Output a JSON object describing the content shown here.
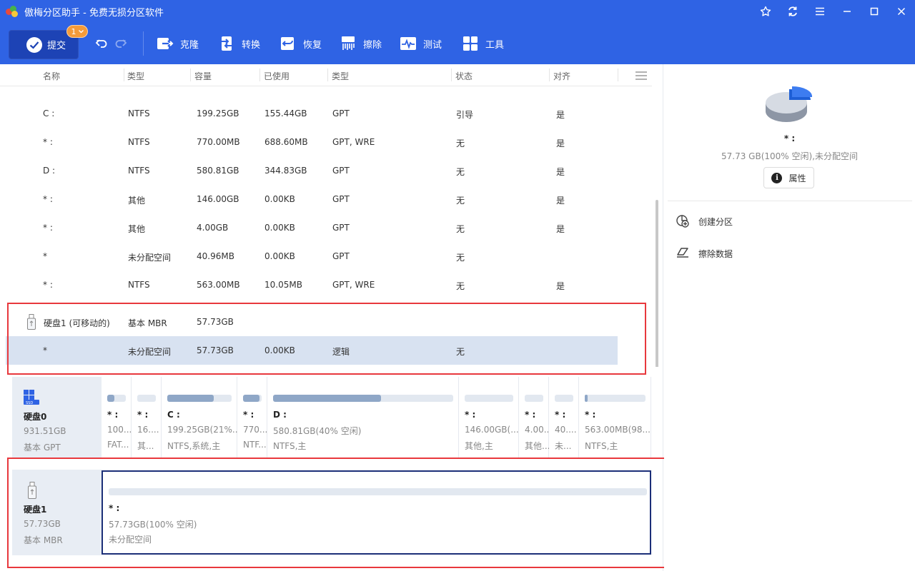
{
  "app": {
    "title": "傲梅分区助手 - 免费无损分区软件"
  },
  "toolbar": {
    "commit_label": "提交",
    "pending_count": "1",
    "tools": [
      {
        "label": "克隆",
        "icon": "clone-icon"
      },
      {
        "label": "转换",
        "icon": "convert-icon"
      },
      {
        "label": "恢复",
        "icon": "recover-icon"
      },
      {
        "label": "擦除",
        "icon": "wipe-icon"
      },
      {
        "label": "测试",
        "icon": "test-icon"
      },
      {
        "label": "工具",
        "icon": "tools-icon"
      }
    ]
  },
  "list": {
    "headers": [
      "名称",
      "类型",
      "容量",
      "已使用",
      "类型",
      "状态",
      "对齐"
    ],
    "rows": [
      {
        "name": "C :",
        "fs": "NTFS",
        "capacity": "199.25GB",
        "used": "155.44GB",
        "type": "GPT",
        "status": "引导",
        "align": "是"
      },
      {
        "name": "* :",
        "fs": "NTFS",
        "capacity": "770.00MB",
        "used": "688.60MB",
        "type": "GPT, WRE",
        "status": "无",
        "align": "是"
      },
      {
        "name": "D :",
        "fs": "NTFS",
        "capacity": "580.81GB",
        "used": "344.83GB",
        "type": "GPT",
        "status": "无",
        "align": "是"
      },
      {
        "name": "* :",
        "fs": "其他",
        "capacity": "146.00GB",
        "used": "0.00KB",
        "type": "GPT",
        "status": "无",
        "align": "是"
      },
      {
        "name": "* :",
        "fs": "其他",
        "capacity": "4.00GB",
        "used": "0.00KB",
        "type": "GPT",
        "status": "无",
        "align": "是"
      },
      {
        "name": "*",
        "fs": "未分配空间",
        "capacity": "40.96MB",
        "used": "0.00KB",
        "type": "GPT",
        "status": "无",
        "align": ""
      },
      {
        "name": "* :",
        "fs": "NTFS",
        "capacity": "563.00MB",
        "used": "10.05MB",
        "type": "GPT, WRE",
        "status": "无",
        "align": "是"
      }
    ],
    "disk1_row": {
      "name": "硬盘1 (可移动的)",
      "type": "基本 MBR",
      "capacity": "57.73GB"
    },
    "disk1_part": {
      "name": "*",
      "fs": "未分配空间",
      "capacity": "57.73GB",
      "used": "0.00KB",
      "type": "逻辑",
      "status": "无"
    }
  },
  "disk0": {
    "name": "硬盘0",
    "size": "931.51GB",
    "style": "基本 GPT",
    "partitions": [
      {
        "label": "* :",
        "size": "100...",
        "type": "FAT...",
        "used_fraction": 0.4
      },
      {
        "label": "* :",
        "size": "16....",
        "type": "其...",
        "used_fraction": 0.0
      },
      {
        "label": "C :",
        "size": "199.25GB(21%...",
        "type": "NTFS,系统,主",
        "used_fraction": 0.72
      },
      {
        "label": "* :",
        "size": "770....",
        "type": "NTF...",
        "used_fraction": 0.9
      },
      {
        "label": "D :",
        "size": "580.81GB(40% 空闲)",
        "type": "NTFS,主",
        "used_fraction": 0.6
      },
      {
        "label": "* :",
        "size": "146.00GB(...",
        "type": "其他,主",
        "used_fraction": 0.0
      },
      {
        "label": "* :",
        "size": "4.00...",
        "type": "其他...",
        "used_fraction": 0.0
      },
      {
        "label": "* :",
        "size": "40....",
        "type": "未...",
        "used_fraction": 0.0
      },
      {
        "label": "* :",
        "size": "563.00MB(98...",
        "type": "NTFS,主",
        "used_fraction": 0.05
      }
    ]
  },
  "disk1": {
    "name": "硬盘1",
    "size": "57.73GB",
    "style": "基本 MBR",
    "partition": {
      "label": "* :",
      "size": "57.73GB(100% 空闲)",
      "type": "未分配空间",
      "used_fraction": 0.0
    }
  },
  "details": {
    "title": "* :",
    "summary": "57.73 GB(100% 空闲),未分配空间",
    "properties_label": "属性",
    "actions": [
      {
        "label": "创建分区",
        "icon": "create-partition-icon"
      },
      {
        "label": "擦除数据",
        "icon": "eraser-icon"
      }
    ]
  },
  "colors": {
    "brand": "#2f63e4",
    "commit": "#1d43b5",
    "badge": "#f59b3a",
    "selected_row": "#d8e2f1",
    "highlight": "#e8383d"
  }
}
